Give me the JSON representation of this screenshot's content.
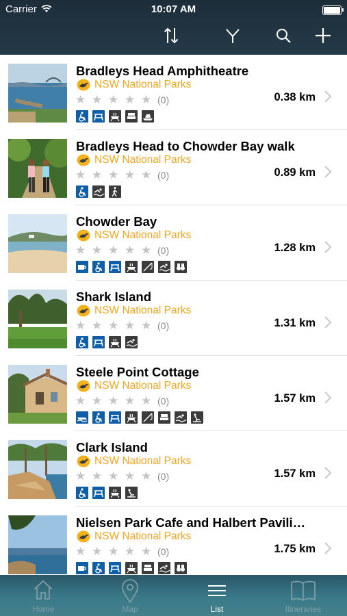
{
  "status_bar": {
    "carrier": "Carrier",
    "time": "10:07 AM"
  },
  "toolbar": {
    "sort_icon": "sort-icon",
    "filter_icon": "filter-icon",
    "search_icon": "search-icon",
    "add_icon": "add-icon"
  },
  "colors": {
    "header": "#1d2d3a",
    "org": "#f3a51d",
    "facility_blue": "#0f5ea8",
    "facility_dark": "#3b3b3b",
    "tabbar": "#3a7a8a"
  },
  "places": [
    {
      "name": "Bradleys Head Amphitheatre",
      "org": "NSW National Parks",
      "rating": 0,
      "rating_count": "(0)",
      "distance": "0.38 km",
      "facilities": [
        "accessible",
        "picnic",
        "bbq",
        "toilets",
        "boat-ramp"
      ]
    },
    {
      "name": "Bradleys Head to Chowder Bay walk",
      "org": "NSW National Parks",
      "rating": 0,
      "rating_count": "(0)",
      "distance": "0.89 km",
      "facilities": [
        "accessible",
        "swimming",
        "walking"
      ]
    },
    {
      "name": "Chowder Bay",
      "org": "NSW National Parks",
      "rating": 0,
      "rating_count": "(0)",
      "distance": "1.28 km",
      "facilities": [
        "cafe",
        "accessible",
        "picnic",
        "bbq",
        "fishing",
        "swimming",
        "lookout"
      ]
    },
    {
      "name": "Shark Island",
      "org": "NSW National Parks",
      "rating": 0,
      "rating_count": "(0)",
      "distance": "1.31 km",
      "facilities": [
        "accessible",
        "picnic",
        "bbq",
        "swimming"
      ]
    },
    {
      "name": "Steele Point Cottage",
      "org": "NSW National Parks",
      "rating": 0,
      "rating_count": "(0)",
      "distance": "1.57 km",
      "facilities": [
        "boating",
        "accessible",
        "picnic",
        "bbq",
        "fishing",
        "toilets",
        "swimming",
        "diving"
      ]
    },
    {
      "name": "Clark Island",
      "org": "NSW National Parks",
      "rating": 0,
      "rating_count": "(0)",
      "distance": "1.57 km",
      "facilities": [
        "accessible",
        "picnic",
        "bbq",
        "diving"
      ]
    },
    {
      "name": "Nielsen Park Cafe and Halbert Pavili…",
      "org": "NSW National Parks",
      "rating": 0,
      "rating_count": "(0)",
      "distance": "1.75 km",
      "facilities": [
        "cafe",
        "accessible",
        "picnic",
        "bbq",
        "toilets",
        "swimming",
        "lookout"
      ]
    }
  ],
  "tabs": [
    {
      "label": "Home",
      "icon": "home-icon",
      "active": false
    },
    {
      "label": "Map",
      "icon": "map-pin-icon",
      "active": false
    },
    {
      "label": "List",
      "icon": "list-icon",
      "active": true
    },
    {
      "label": "Itineraries",
      "icon": "book-icon",
      "active": false
    }
  ]
}
